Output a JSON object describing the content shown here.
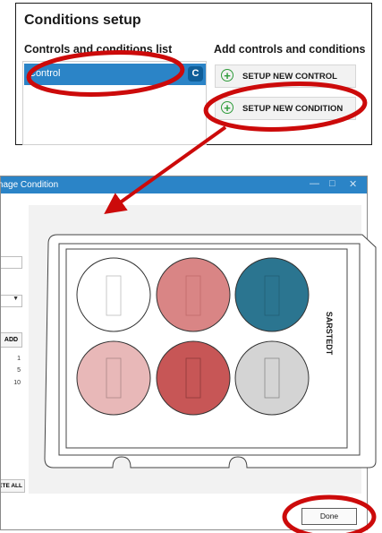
{
  "top_panel": {
    "title": "Conditions setup",
    "list_title": "Controls and conditions list",
    "right_title": "Add controls and conditions",
    "list_items": [
      {
        "label": "Control",
        "badge": "C"
      }
    ],
    "buttons": {
      "new_control": "SETUP NEW CONTROL",
      "new_condition": "SETUP NEW CONDITION"
    }
  },
  "dialog": {
    "title": "Manage Condition",
    "add_label": "ADD",
    "values": [
      "1",
      "5",
      "10"
    ],
    "delete_all_label": "DELETE ALL",
    "done_label": "Done",
    "plate": {
      "brand": "SARSTEDT",
      "well_colors": [
        "#ffffff",
        "#d98585",
        "#2b7590",
        "#e8b8b8",
        "#c75656",
        "#d4d4d4"
      ]
    }
  },
  "colors": {
    "accent_blue": "#2b84c7",
    "annotation_red": "#cc0a0a",
    "plus_green": "#2e9b3a"
  }
}
